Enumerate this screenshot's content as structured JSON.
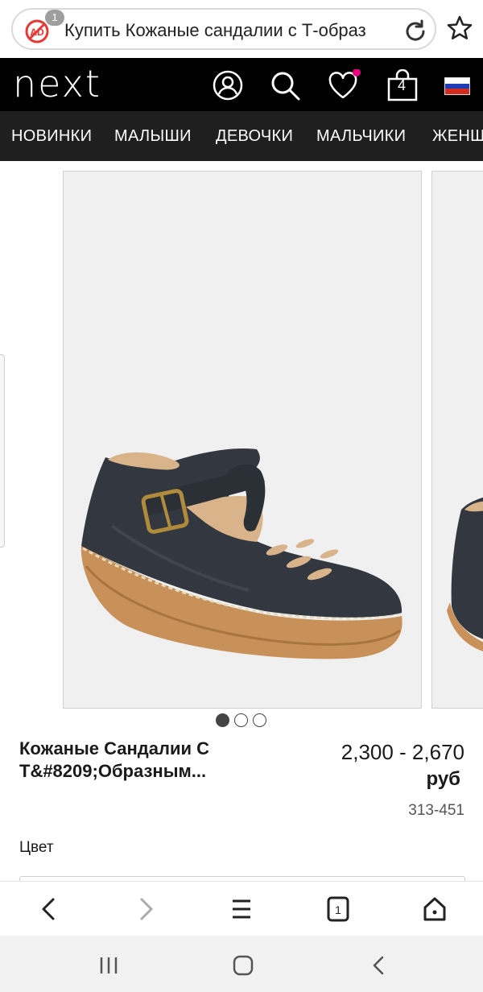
{
  "browser": {
    "adblock_count": "1",
    "url_text": "Купить Кожаные сандалии с Т-образ"
  },
  "site": {
    "logo": "next",
    "bag_count": "4"
  },
  "categories": [
    "НОВИНКИ",
    "МАЛЫШИ",
    "ДЕВОЧКИ",
    "МАЛЬЧИКИ",
    "ЖЕНЩ"
  ],
  "carousel": {
    "total": 3,
    "active": 1
  },
  "product": {
    "title": "Кожаные Сандалии С Т&#8209;Образным...",
    "price": "2,300 - 2,670",
    "currency": "руб",
    "sku": "313-451",
    "color_label": "Цвет"
  },
  "browser_toolbar": {
    "tab_count": "1"
  },
  "colors": {
    "header_bg": "#000000",
    "nav_bg": "#1f1f1f",
    "wishlist_dot": "#e6007e",
    "leather": "#33373f",
    "sole": "#c9915a"
  },
  "icons": {
    "adblock": "adblock-icon",
    "reload": "reload-icon",
    "star": "star-icon",
    "account": "account-icon",
    "search": "search-icon",
    "wishlist": "heart-icon",
    "bag": "bag-icon",
    "flag": "russia-flag-icon"
  }
}
